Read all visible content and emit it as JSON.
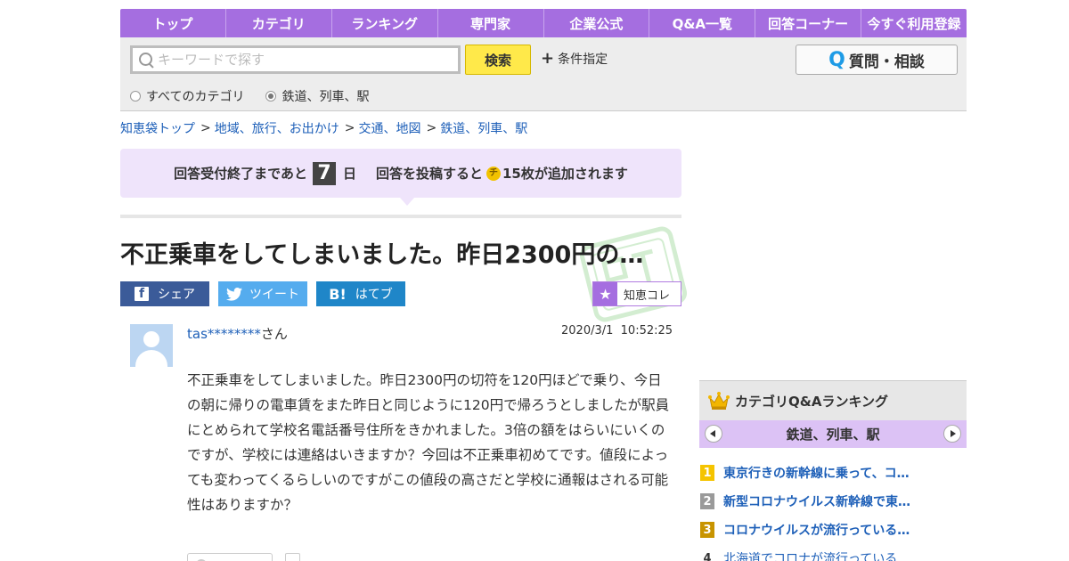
{
  "nav": {
    "items": [
      "トップ",
      "カテゴリ",
      "ランキング",
      "専門家",
      "企業公式",
      "Q&A一覧",
      "回答コーナー",
      "今すぐ利用登録"
    ],
    "color": "#a56ee0"
  },
  "search": {
    "placeholder": "キーワードで探す",
    "value": "",
    "button_label": "検索",
    "conditions_label": "条件指定",
    "scope_options": [
      "すべてのカテゴリ",
      "鉄道、列車、駅"
    ],
    "selected_scope": "鉄道、列車、駅",
    "ask_button_label": "質問・相談",
    "ask_button_icon": "Q"
  },
  "breadcrumb": [
    "知恵袋トップ",
    "地域、旅行、お出かけ",
    "交通、地図",
    "鉄道、列車、駅"
  ],
  "notice": {
    "prefix": "回答受付終了まであと",
    "days": "7",
    "days_unit": "日",
    "reward_prefix": "回答を投稿すると",
    "coin_symbol": "チ",
    "reward_suffix": "15枚が追加されます"
  },
  "question": {
    "title": "不正乗車をしてしまいました。昨日2300円の…",
    "user_name": "tas********",
    "user_suffix": "さん",
    "posted_at": "2020/3/1  10:52:25",
    "body": "不正乗車をしてしまいました。昨日2300円の切符を120円ほどで乗り、今日の朝に帰りの電車賃をまた昨日と同じように120円で帰ろうとしましたが駅員にとめられて学校名電話番号住所をきかれました。3倍の額をはらいにいくのですが、学校には連絡はいきますか？今回は不正乗車初めてです。値段によっても変わってくるらしいのですがこの値段の高さだと学校に通報はされる可能性はありますか？"
  },
  "share": {
    "facebook_label": "シェア",
    "facebook_icon": "f",
    "twitter_label": "ツイート",
    "hatena_label": "はてブ",
    "hatena_icon": "B!",
    "chie_label": "知恵コレ",
    "star_icon": "★",
    "colors": {
      "facebook": "#3b5b99",
      "twitter": "#55acee",
      "hatena": "#1f86c8"
    }
  },
  "ranking": {
    "title": "カテゴリQ&Aランキング",
    "category": "鉄道、列車、駅",
    "items": [
      {
        "rank": "1",
        "text": "東京行きの新幹線に乗って、コ…",
        "badge_color": "#f5c400"
      },
      {
        "rank": "2",
        "text": "新型コロナウイルス新幹線で東…",
        "badge_color": "#9a9a9a"
      },
      {
        "rank": "3",
        "text": "コロナウイルスが流行っている…",
        "badge_color": "#c89400"
      },
      {
        "rank": "4",
        "text": "北海道でコロナが流行っている…",
        "badge_color": ""
      }
    ]
  }
}
